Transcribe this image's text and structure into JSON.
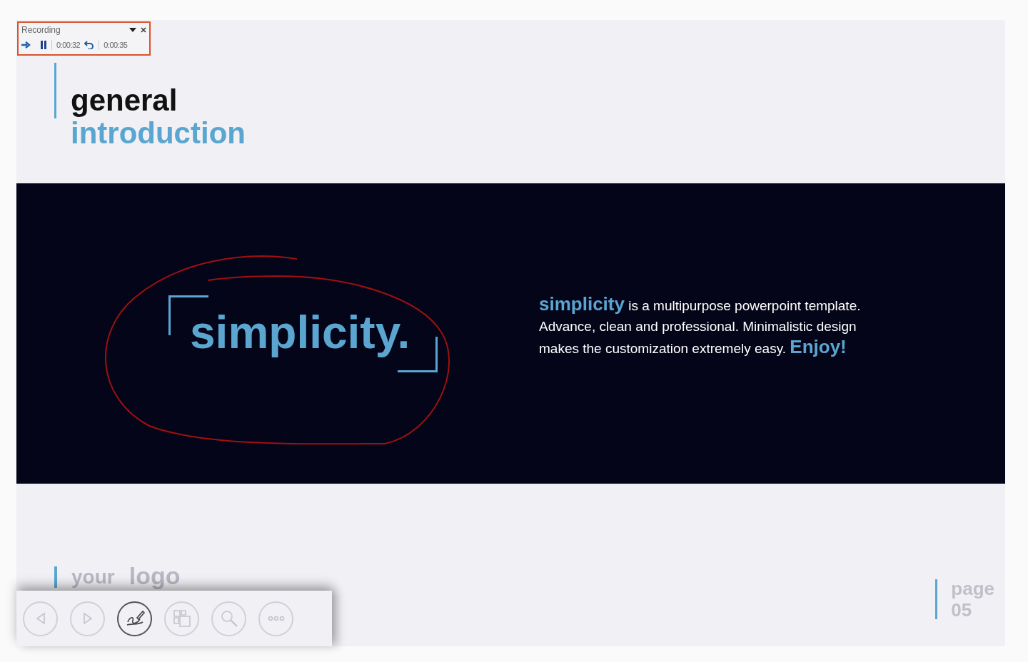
{
  "recording_toolbar": {
    "title": "Recording",
    "elapsed": "0:00:32",
    "total": "0:00:35",
    "paused": false
  },
  "slide": {
    "heading": {
      "line1": "general",
      "line2": "introduction"
    },
    "feature_word": "simplicity.",
    "description": [
      {
        "kind": "highlight",
        "text": "simplicity"
      },
      {
        "kind": "plain",
        "text": " is a multipurpose powerpoint template. Advance, clean and professional. Minimalistic design makes the customization extremely easy. "
      },
      {
        "kind": "highlight",
        "text": "Enjoy!"
      }
    ],
    "logo": {
      "line1": "your",
      "line2": "logo"
    },
    "page": {
      "label": "page",
      "number": "05"
    }
  },
  "presenter_toolbar": [
    {
      "kind": "previous",
      "selected": false
    },
    {
      "kind": "next",
      "selected": false
    },
    {
      "kind": "pen",
      "selected": true
    },
    {
      "kind": "slides",
      "selected": false
    },
    {
      "kind": "zoom",
      "selected": false
    },
    {
      "kind": "more",
      "selected": false
    }
  ]
}
